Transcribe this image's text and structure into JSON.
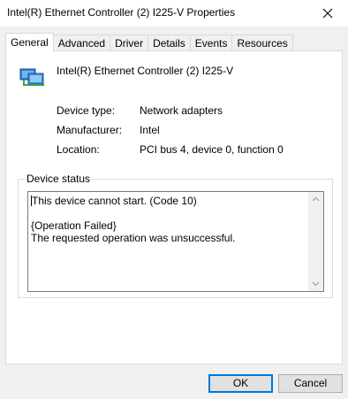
{
  "window": {
    "title": "Intel(R) Ethernet Controller (2) I225-V Properties"
  },
  "tabs": [
    {
      "label": "General",
      "active": true
    },
    {
      "label": "Advanced",
      "active": false
    },
    {
      "label": "Driver",
      "active": false
    },
    {
      "label": "Details",
      "active": false
    },
    {
      "label": "Events",
      "active": false
    },
    {
      "label": "Resources",
      "active": false
    }
  ],
  "device": {
    "icon": "network-adapter-icon",
    "name": "Intel(R) Ethernet Controller (2) I225-V"
  },
  "properties": [
    {
      "label": "Device type:",
      "value": "Network adapters"
    },
    {
      "label": "Manufacturer:",
      "value": "Intel"
    },
    {
      "label": "Location:",
      "value": "PCI bus 4, device 0, function 0"
    }
  ],
  "device_status": {
    "legend": "Device status",
    "text": "This device cannot start. (Code 10)\n\n{Operation Failed}\nThe requested operation was unsuccessful."
  },
  "buttons": {
    "ok": "OK",
    "cancel": "Cancel"
  },
  "colors": {
    "accent": "#0078d7",
    "window_bg": "#f0f0f0",
    "panel_bg": "#ffffff"
  }
}
